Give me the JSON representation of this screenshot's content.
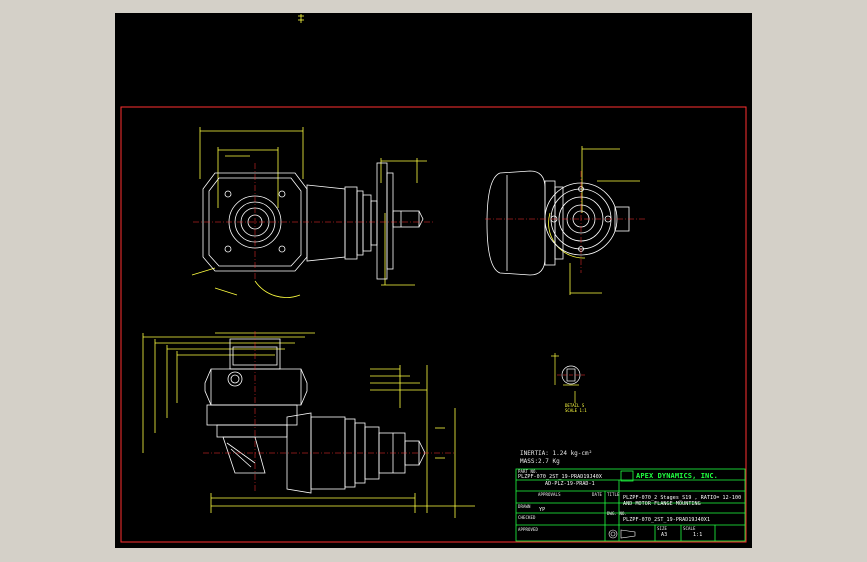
{
  "drawing": {
    "notes": {
      "inertia": "INERTIA: 1.24 kg-cm²",
      "mass": "MASS:2.7 Kg"
    },
    "title_block": {
      "part_no_label": "PART NO.",
      "part_no_line1": "PLZPF-070_2ST_19-PRAD19J40X",
      "part_no_line2": "AD-PLZ-19-PRAD-1",
      "company": "APEX DYNAMICS, INC.",
      "approvals_label": "APPROVALS",
      "date_label": "DATE",
      "title_label": "TITLE",
      "title_line1": "PLZPF-070_2 Stages_S19 , RATIO= 12-100",
      "title_line2": "AND MOTOR FLANGE MOUNTING",
      "drawn_label": "DRAWN",
      "drawn_value": "YP",
      "dwg_no_label": "DWG. NO.",
      "dwg_no_value": "PLZPF-070_2ST_19-PRAD19J40X1",
      "checked_label": "CHECKED",
      "approved_label": "APPROVED",
      "size_label": "SIZE",
      "size_value": "A3",
      "scale_label": "SCALE",
      "scale_value": "1:1"
    },
    "detail_label_1": "DETAIL S",
    "detail_label_2": "SCALE 1:1"
  },
  "colors": {
    "background": "#000000",
    "border": "#ff3030",
    "geometry": "#ffffff",
    "dimension": "#ffff40",
    "titleblock": "#20ff40"
  }
}
